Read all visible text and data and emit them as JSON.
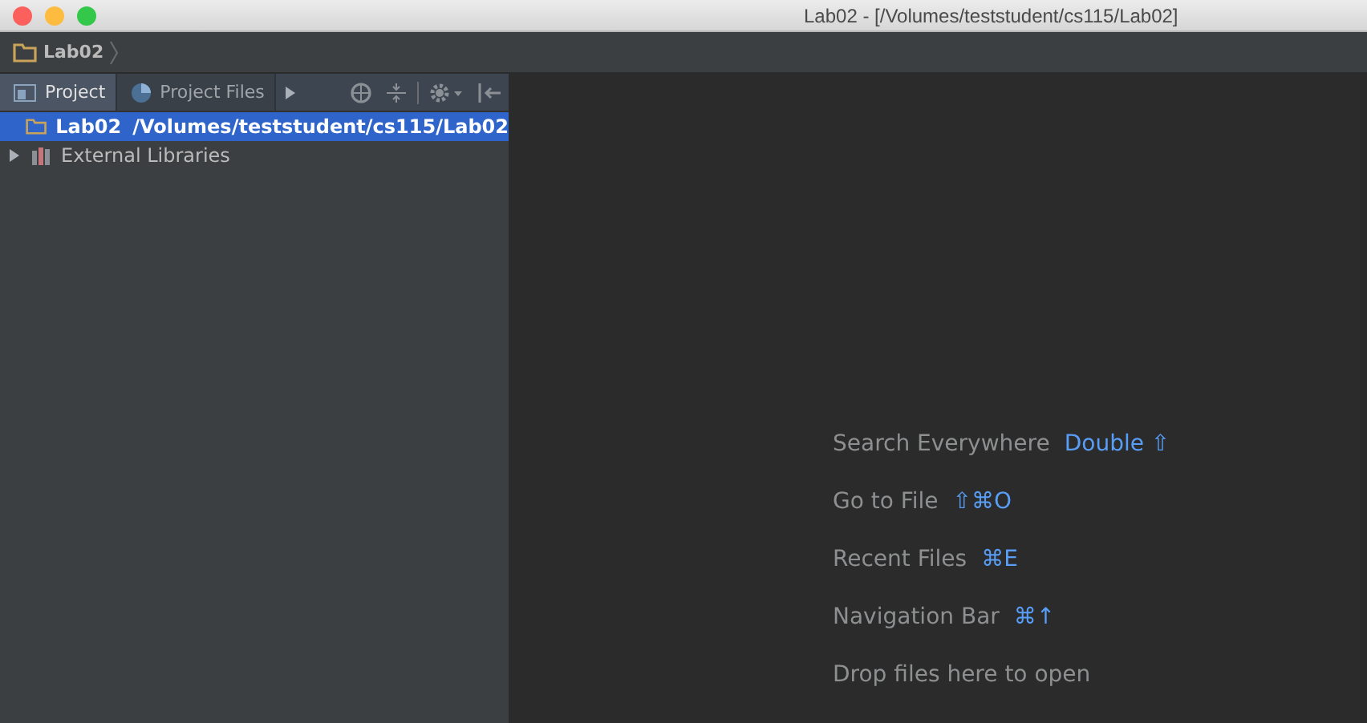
{
  "window": {
    "title": "Lab02 - [/Volumes/teststudent/cs115/Lab02]"
  },
  "breadcrumb": [
    "Lab02"
  ],
  "tabs": [
    {
      "label": "Project",
      "selected": true
    },
    {
      "label": "Project Files",
      "selected": false
    }
  ],
  "tree": [
    {
      "kind": "folder",
      "label": "Lab02",
      "path": "/Volumes/teststudent/cs115/Lab02",
      "selected": true
    },
    {
      "kind": "library",
      "label": "External Libraries",
      "selected": false,
      "expanded": false
    }
  ],
  "hints": [
    {
      "label": "Search Everywhere",
      "keys": "Double ⇧"
    },
    {
      "label": "Go to File",
      "keys": "⇧⌘O"
    },
    {
      "label": "Recent Files",
      "keys": "⌘E"
    },
    {
      "label": "Navigation Bar",
      "keys": "⌘↑"
    },
    {
      "label": "Drop files here to open"
    }
  ]
}
